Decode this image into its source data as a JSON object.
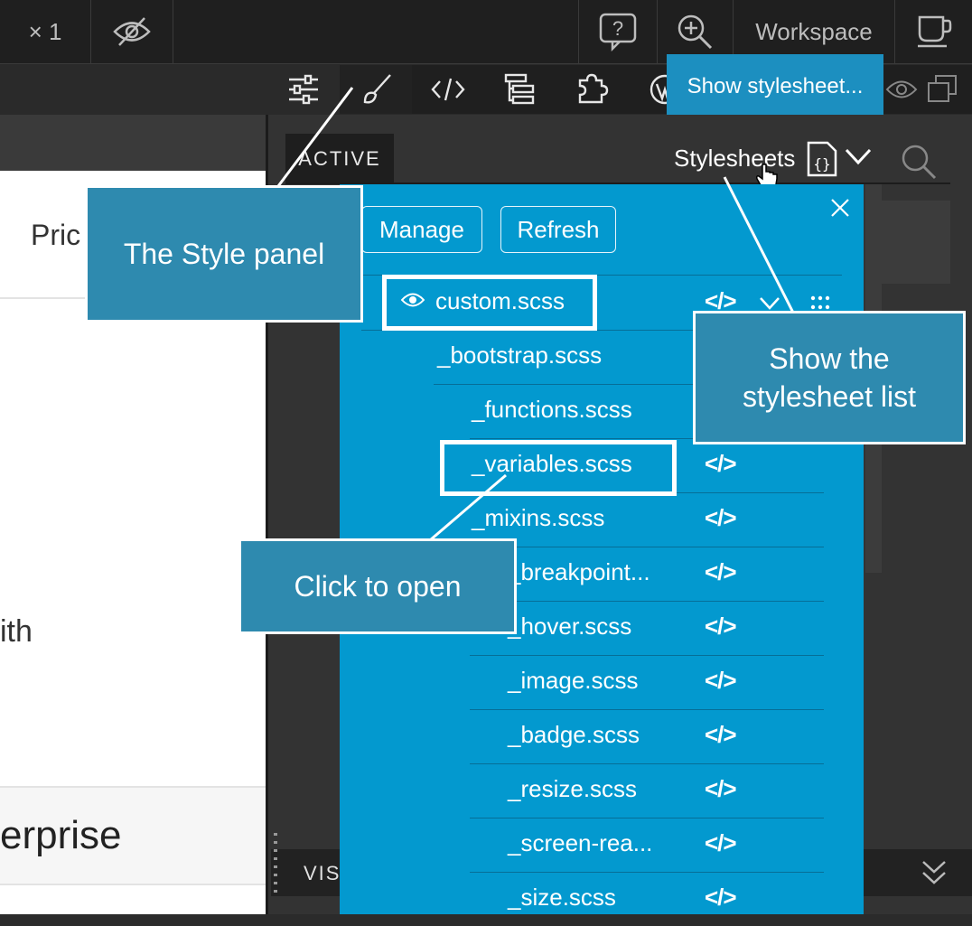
{
  "topbar": {
    "zoom_label": "× 1",
    "workspace_label": "Workspace"
  },
  "tooltip": {
    "text": "Show stylesheet..."
  },
  "preview": {
    "nav_text": "Pric",
    "body_text": "ith",
    "card_title": "erprise"
  },
  "panel": {
    "active_tab": "ACTIVE",
    "stylesheets_label": "Stylesheets",
    "bottom_tab": "VIS"
  },
  "stylesheets": {
    "manage_label": "Manage",
    "refresh_label": "Refresh",
    "items": [
      {
        "name": "custom.scss",
        "level": 0,
        "code": "</>"
      },
      {
        "name": "_bootstrap.scss",
        "level": 1,
        "code": ""
      },
      {
        "name": "_functions.scss",
        "level": 2,
        "code": ""
      },
      {
        "name": "_variables.scss",
        "level": 2,
        "code": "</>"
      },
      {
        "name": "_mixins.scss",
        "level": 2,
        "code": "</>"
      },
      {
        "name": "_breakpoint...",
        "level": 3,
        "code": "</>"
      },
      {
        "name": "_hover.scss",
        "level": 3,
        "code": "</>"
      },
      {
        "name": "_image.scss",
        "level": 3,
        "code": "</>"
      },
      {
        "name": "_badge.scss",
        "level": 3,
        "code": "</>"
      },
      {
        "name": "_resize.scss",
        "level": 3,
        "code": "</>"
      },
      {
        "name": "_screen-rea...",
        "level": 3,
        "code": "</>"
      },
      {
        "name": "_size.scss",
        "level": 3,
        "code": "</>"
      }
    ]
  },
  "callouts": {
    "style_panel": "The Style panel",
    "show_list": "Show the stylesheet list",
    "click_open": "Click to open"
  },
  "colors": {
    "dropdown_bg": "#0399cf",
    "callout_bg": "#2e8aaf",
    "tooltip_bg": "#1c8fc0"
  }
}
